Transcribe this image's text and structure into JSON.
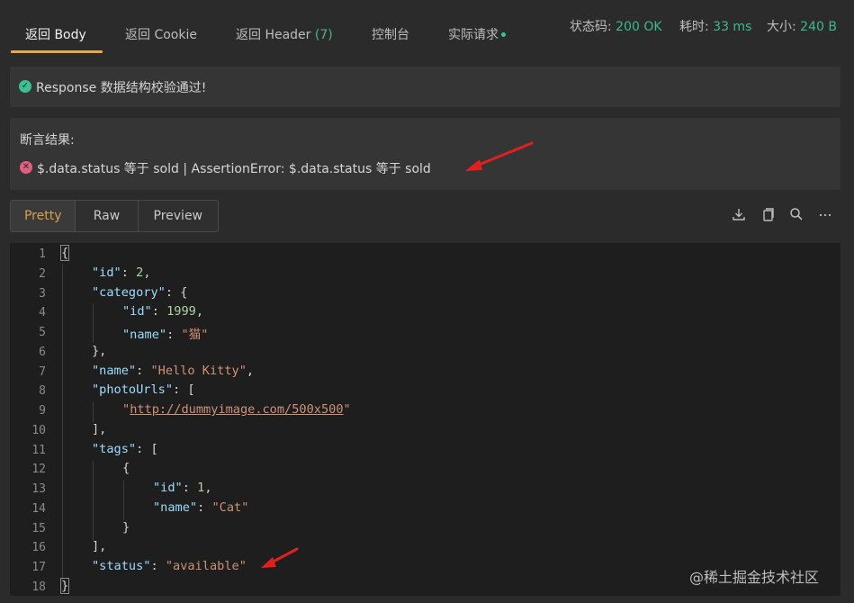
{
  "tabs": [
    {
      "label": "返回 Body"
    },
    {
      "label": "返回 Cookie"
    },
    {
      "label": "返回 Header ",
      "count": "(7)"
    },
    {
      "label": "控制台"
    },
    {
      "label": "实际请求"
    }
  ],
  "meta": {
    "status_label": "状态码: ",
    "status_value": "200 OK",
    "time_label": "耗时: ",
    "time_value": "33 ms",
    "size_label": "大小: ",
    "size_value": "240 B"
  },
  "validation": {
    "text": "Response 数据结构校验通过!"
  },
  "assertion": {
    "title": "断言结果:",
    "error_text": "$.data.status 等于 sold | AssertionError: $.data.status 等于 sold"
  },
  "view_modes": [
    "Pretty",
    "Raw",
    "Preview"
  ],
  "toolbar_icons": [
    "download-icon",
    "copy-icon",
    "search-icon",
    "more-icon"
  ],
  "code": {
    "line_numbers": [
      "1",
      "2",
      "3",
      "4",
      "5",
      "6",
      "7",
      "8",
      "9",
      "10",
      "11",
      "12",
      "13",
      "14",
      "15",
      "16",
      "17",
      "18"
    ],
    "open_brace": "{",
    "close_brace": "}",
    "l2_key": "\"id\"",
    "l2_val": "2",
    "l3_key": "\"category\"",
    "l4_key": "\"id\"",
    "l4_val": "1999",
    "l5_key": "\"name\"",
    "l5_val": "\"猫\"",
    "l7_key": "\"name\"",
    "l7_val": "\"Hello Kitty\"",
    "l8_key": "\"photoUrls\"",
    "l9_q1": "\"",
    "l9_url": "http://dummyimage.com/500x500",
    "l9_q2": "\"",
    "l11_key": "\"tags\"",
    "l14_key": "\"id\"",
    "l14_val": "1",
    "l15_key": "\"name\"",
    "l15_val": "\"Cat\"",
    "l17_key": "\"status\"",
    "l17_val": "\"available\""
  },
  "watermark": "@稀土掘金技术社区"
}
